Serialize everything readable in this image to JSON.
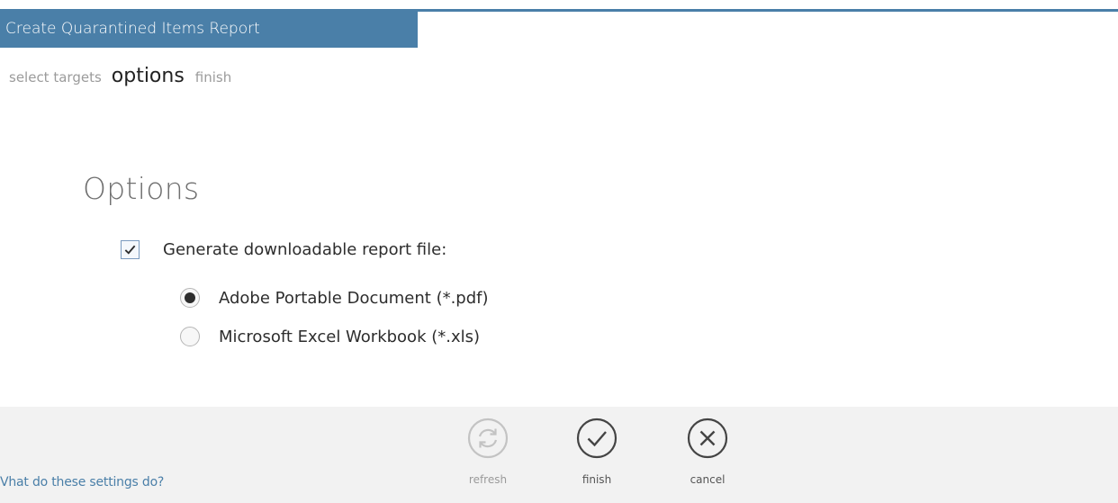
{
  "window": {
    "title": "Create Quarantined Items Report"
  },
  "steps": [
    {
      "label": "select targets",
      "active": false
    },
    {
      "label": "options",
      "active": true
    },
    {
      "label": "finish",
      "active": false
    }
  ],
  "options": {
    "heading": "Options",
    "generate_file": {
      "label": "Generate downloadable report file:",
      "checked": true
    },
    "formats": [
      {
        "label": "Adobe Portable Document (*.pdf)",
        "selected": true
      },
      {
        "label": "Microsoft Excel Workbook (*.xls)",
        "selected": false
      }
    ]
  },
  "footer": {
    "help_link": "Vhat do these settings do?",
    "actions": {
      "refresh": {
        "label": "refresh",
        "icon": "refresh-icon",
        "enabled": false
      },
      "finish": {
        "label": "finish",
        "icon": "checkmark-circle-icon",
        "enabled": true
      },
      "cancel": {
        "label": "cancel",
        "icon": "close-circle-icon",
        "enabled": true
      }
    }
  },
  "colors": {
    "accent": "#4a7fa8",
    "footer_background": "#f2f2f2",
    "inactive_step": "#9b9b9b",
    "disabled_icon": "#c3c3c3"
  }
}
